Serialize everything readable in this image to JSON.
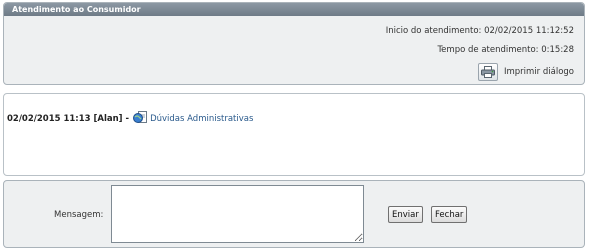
{
  "header": {
    "title": "Atendimento ao Consumidor"
  },
  "session": {
    "start_text": "Inicio do atendimento: 02/02/2015  11:12:52",
    "duration_text": "Tempo de atendimento: 0:15:28",
    "print_label": "Imprimir diálogo"
  },
  "chat": {
    "messages": [
      {
        "meta": "02/02/2015 11:13 [Alan]",
        "separator": "-",
        "topic": "Dúvidas Administrativas"
      }
    ]
  },
  "composer": {
    "label": "Mensagem:",
    "value": "",
    "send_label": "Enviar",
    "close_label": "Fechar"
  },
  "icons": {
    "print": "printer-icon",
    "topic": "globe-document-icon"
  }
}
